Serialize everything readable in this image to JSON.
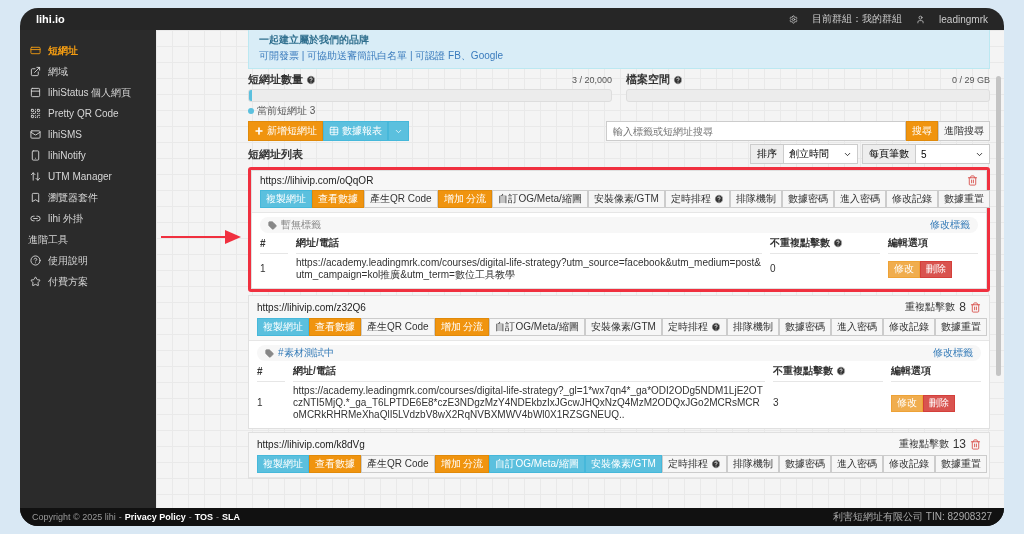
{
  "topbar": {
    "brand": "lihi.io",
    "group": "目前群組：我的群組",
    "user": "leadingmrk"
  },
  "sidebar": {
    "items": [
      {
        "label": "短網址",
        "selected": true
      },
      {
        "label": "網域",
        "selected": false
      },
      {
        "label": "lihiStatus 個人網頁",
        "selected": false
      },
      {
        "label": "Pretty QR Code",
        "selected": false
      },
      {
        "label": "lihiSMS",
        "selected": false
      },
      {
        "label": "lihiNotify",
        "selected": false
      },
      {
        "label": "UTM Manager",
        "selected": false
      },
      {
        "label": "瀏覽器套件",
        "selected": false
      },
      {
        "label": "lihi 外掛",
        "selected": false
      }
    ],
    "section": {
      "label": "進階工具",
      "items": [
        {
          "label": "使用說明",
          "selected": false
        },
        {
          "label": "付費方案",
          "selected": false
        }
      ]
    }
  },
  "notice": {
    "title": "一起建立屬於我們的品牌",
    "text": "可開發票 | 可協助送審簡訊白名單 | 可認證 FB、Google"
  },
  "meters": [
    {
      "title": "短網址數量",
      "reading": "3 / 20,000",
      "level": 0.00015,
      "legend": "當前短網址 3"
    },
    {
      "title": "檔案空間",
      "reading": "0 / 29 GB"
    }
  ],
  "toolbar": {
    "create": "新增短網址",
    "report": "數據報表",
    "search_placeholder": "輸入標籤或短網址搜尋",
    "search": "搜尋",
    "advanced": "進階搜尋"
  },
  "list": {
    "title": "短網址列表",
    "sort_label": "排序",
    "sort_value": "創立時間",
    "per_page_label": "每頁筆數",
    "per_page_value": "5"
  },
  "cards": [
    {
      "url": "https://lihivip.com/oQqOR",
      "highlighted": true,
      "actions": [
        {
          "label": "複製網址",
          "kind": "info"
        },
        {
          "label": "查看數據",
          "kind": "warning"
        },
        {
          "label": "產生QR Code",
          "kind": "default"
        }
      ],
      "tools": [
        {
          "label": "增加 分流",
          "kind": "warning",
          "help": false
        },
        {
          "label": "自訂OG/Meta/縮圖",
          "kind": "default",
          "help": false
        },
        {
          "label": "安裝像素/GTM",
          "kind": "default",
          "help": false
        },
        {
          "label": "定時排程",
          "kind": "default",
          "help": true
        },
        {
          "label": "排隊機制",
          "kind": "default",
          "help": false
        },
        {
          "label": "數據密碼",
          "kind": "default",
          "help": false
        },
        {
          "label": "進入密碼",
          "kind": "default",
          "help": false
        },
        {
          "label": "修改記錄",
          "kind": "default",
          "help": false
        },
        {
          "label": "數據重置",
          "kind": "default",
          "help": false
        }
      ],
      "tag": {
        "text": "暫無標籤",
        "kind": "empty"
      },
      "edit_tag": "修改標籤",
      "columns": [
        {
          "label": "#",
          "help": false
        },
        {
          "label": "網址/電話",
          "help": false
        },
        {
          "label": "不重複點擊數",
          "help": true
        },
        {
          "label": "編輯選項",
          "help": false
        }
      ],
      "rows": [
        {
          "index": "1",
          "url": "https://academy.leadingmrk.com/courses/digital-life-strategy?utm_source=facebook&utm_medium=post&utm_campaign=kol推廣&utm_term=數位工具教學",
          "clicks": "0",
          "edit": "修改",
          "delete": "刪除"
        }
      ]
    },
    {
      "url": "https://lihivip.com/z32Q6",
      "highlighted": false,
      "repeat_label": "重複點擊數",
      "repeat_value": "8",
      "actions": [
        {
          "label": "複製網址",
          "kind": "info"
        },
        {
          "label": "查看數據",
          "kind": "warning"
        },
        {
          "label": "產生QR Code",
          "kind": "default"
        }
      ],
      "tools": [
        {
          "label": "增加 分流",
          "kind": "warning",
          "help": false
        },
        {
          "label": "自訂OG/Meta/縮圖",
          "kind": "default",
          "help": false
        },
        {
          "label": "安裝像素/GTM",
          "kind": "default",
          "help": false
        },
        {
          "label": "定時排程",
          "kind": "default",
          "help": true
        },
        {
          "label": "排隊機制",
          "kind": "default",
          "help": false
        },
        {
          "label": "數據密碼",
          "kind": "default",
          "help": false
        },
        {
          "label": "進入密碼",
          "kind": "default",
          "help": false
        },
        {
          "label": "修改記錄",
          "kind": "default",
          "help": false
        },
        {
          "label": "數據重置",
          "kind": "default",
          "help": false
        }
      ],
      "tag": {
        "text": "#素材測試中",
        "kind": "tag"
      },
      "edit_tag": "修改標籤",
      "columns": [
        {
          "label": "#",
          "help": false
        },
        {
          "label": "網址/電話",
          "help": false
        },
        {
          "label": "不重複點擊數",
          "help": true
        },
        {
          "label": "編輯選項",
          "help": false
        }
      ],
      "rows": [
        {
          "index": "1",
          "url": "https://academy.leadingmrk.com/courses/digital-life-strategy?_gl=1*wx7qn4*_ga*ODI2ODg5NDM1LjE2OTczNTI5MjQ.*_ga_T6LPTDE6E8*czE3NDgzMzY4NDEkbzIxJGcwJHQxNzQ4MzM2ODQxJGo2MCRsMCRoMCRkRHRMeXhaQlI5LVdzbV8wX2RqNVBXMWV4bWl0X1RZSGNEUQ..",
          "clicks": "3",
          "edit": "修改",
          "delete": "刪除"
        }
      ]
    },
    {
      "url": "https://lihivip.com/k8dVg",
      "highlighted": false,
      "repeat_label": "重複點擊數",
      "repeat_value": "13",
      "actions": [
        {
          "label": "複製網址",
          "kind": "info"
        },
        {
          "label": "查看數據",
          "kind": "warning"
        },
        {
          "label": "產生QR Code",
          "kind": "default"
        }
      ],
      "tools": [
        {
          "label": "增加 分流",
          "kind": "warning",
          "help": false
        },
        {
          "label": "自訂OG/Meta/縮圖",
          "kind": "info",
          "help": false
        },
        {
          "label": "安裝像素/GTM",
          "kind": "info",
          "help": false
        },
        {
          "label": "定時排程",
          "kind": "default",
          "help": true
        },
        {
          "label": "排隊機制",
          "kind": "default",
          "help": false
        },
        {
          "label": "數據密碼",
          "kind": "default",
          "help": false
        },
        {
          "label": "進入密碼",
          "kind": "default",
          "help": false
        },
        {
          "label": "修改記錄",
          "kind": "default",
          "help": false
        },
        {
          "label": "數據重置",
          "kind": "default",
          "help": false
        }
      ]
    }
  ],
  "footer": {
    "copyright": "Copyright © 2025 lihi",
    "separator": "-",
    "links": [
      "Privacy Policy",
      "TOS",
      "SLA"
    ],
    "company": "利害短網址有限公司 TIN: 82908327"
  }
}
